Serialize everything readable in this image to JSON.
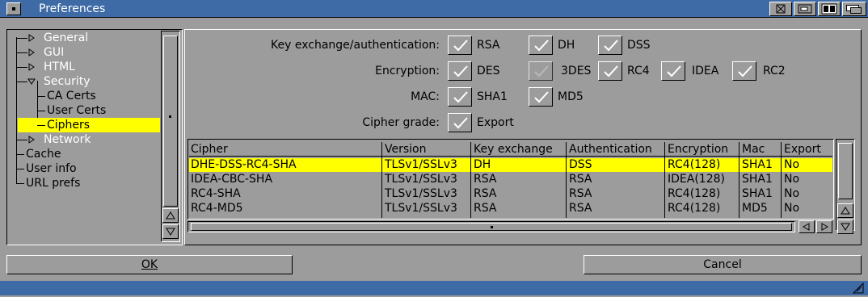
{
  "window": {
    "title": "Preferences"
  },
  "tree": {
    "items": [
      {
        "label": "General",
        "expandable": true,
        "expanded": false,
        "dim": true
      },
      {
        "label": "GUI",
        "expandable": true,
        "expanded": false,
        "dim": true
      },
      {
        "label": "HTML",
        "expandable": true,
        "expanded": false,
        "dim": true
      },
      {
        "label": "Security",
        "expandable": true,
        "expanded": true,
        "dim": true
      },
      {
        "label": "CA Certs",
        "child": true
      },
      {
        "label": "User Certs",
        "child": true
      },
      {
        "label": "Ciphers",
        "child": true,
        "selected": true
      },
      {
        "label": "Network",
        "expandable": true,
        "expanded": false,
        "dim": true
      },
      {
        "label": "Cache"
      },
      {
        "label": "User info"
      },
      {
        "label": "URL prefs"
      }
    ]
  },
  "options": {
    "kx": {
      "label": "Key exchange/authentication:",
      "items": [
        {
          "label": "RSA",
          "checked": true
        },
        {
          "label": "DH",
          "checked": true
        },
        {
          "label": "DSS",
          "checked": true
        }
      ]
    },
    "enc": {
      "label": "Encryption:",
      "items": [
        {
          "label": "DES",
          "checked": true
        },
        {
          "label": "3DES",
          "checked": true,
          "disabled": true
        },
        {
          "label": "RC4",
          "checked": true
        },
        {
          "label": "IDEA",
          "checked": true
        },
        {
          "label": "RC2",
          "checked": true
        }
      ]
    },
    "mac": {
      "label": "MAC:",
      "items": [
        {
          "label": "SHA1",
          "checked": true
        },
        {
          "label": "MD5",
          "checked": true
        }
      ]
    },
    "grade": {
      "label": "Cipher grade:",
      "items": [
        {
          "label": "Export",
          "checked": true
        }
      ]
    }
  },
  "table": {
    "headers": [
      "Cipher",
      "Version",
      "Key exchange",
      "Authentication",
      "Encryption",
      "Mac",
      "Export"
    ],
    "rows": [
      [
        "DHE-DSS-RC4-SHA",
        "TLSv1/SSLv3",
        "DH",
        "DSS",
        "RC4(128)",
        "SHA1",
        "No"
      ],
      [
        "IDEA-CBC-SHA",
        "TLSv1/SSLv3",
        "RSA",
        "RSA",
        "IDEA(128)",
        "SHA1",
        "No"
      ],
      [
        "RC4-SHA",
        "TLSv1/SSLv3",
        "RSA",
        "RSA",
        "RC4(128)",
        "SHA1",
        "No"
      ],
      [
        "RC4-MD5",
        "TLSv1/SSLv3",
        "RSA",
        "RSA",
        "RC4(128)",
        "MD5",
        "No"
      ]
    ],
    "selected_row": 0
  },
  "buttons": {
    "ok": "OK",
    "cancel": "Cancel"
  },
  "colors": {
    "titlebar": "#3e6aa6",
    "background": "#9c9c9c",
    "selection": "#ffff00"
  }
}
